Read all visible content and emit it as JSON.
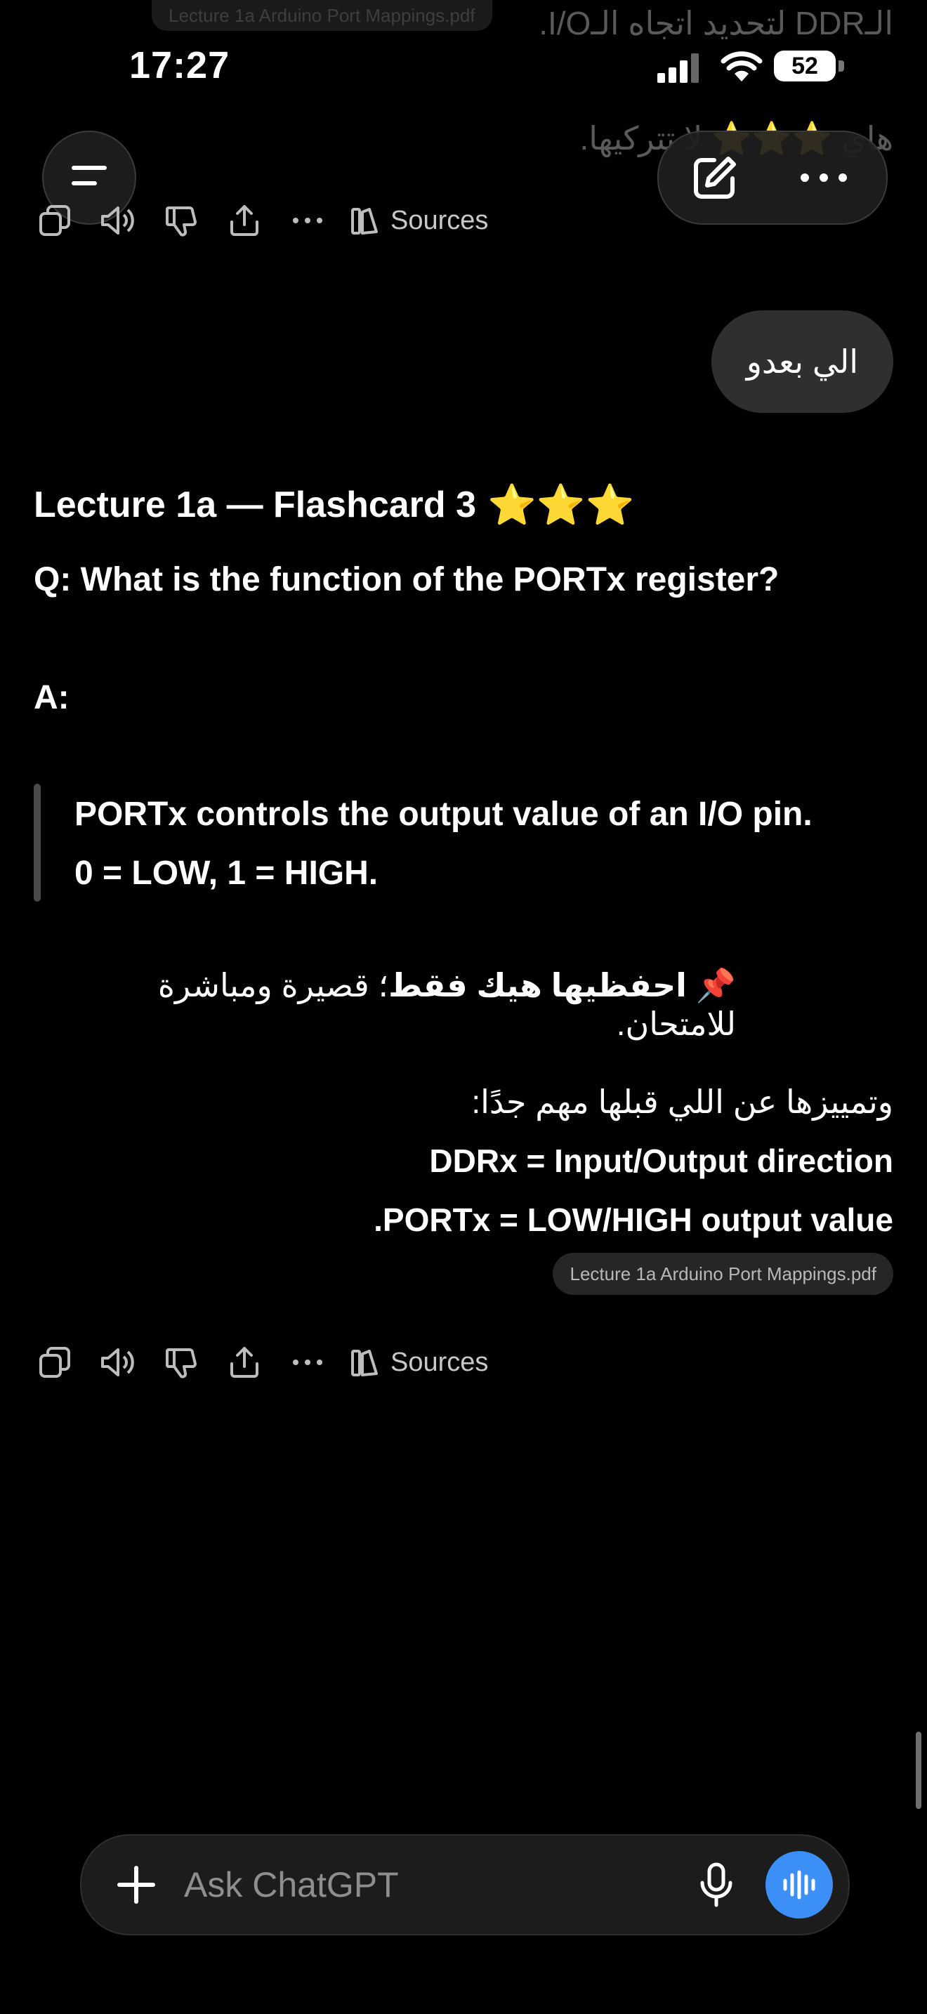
{
  "background_prev": {
    "line1": "الـDDR لتحديد اتجاه الـI/O.",
    "line2": "هاي ⭐⭐⭐ لا تتركيها.",
    "file_chip": "Lecture 1a Arduino Port Mappings.pdf"
  },
  "status_bar": {
    "time": "17:27",
    "battery": "52"
  },
  "prev_actions": {
    "sources_label": "Sources"
  },
  "user_message": {
    "text": "الي بعدو"
  },
  "assistant": {
    "title": "Lecture 1a — Flashcard 3",
    "stars": "⭐⭐⭐",
    "question": "Q: What is the function of the PORTx register?",
    "answer_label": "A:",
    "quote": [
      "PORTx controls the output value of an I/O pin.",
      "0 = LOW, 1 = HIGH."
    ],
    "memorize_bold": "احفظيها هيك فقط",
    "memorize_rest": "؛ قصيرة ومباشرة للامتحان.",
    "pin_emoji": "📌",
    "distinguish_intro": "وتمييزها عن اللي قبلها مهم جدًا:",
    "ddr_line": "DDRx = Input/Output direction",
    "port_line": ".PORTx = LOW/HIGH output value",
    "file_chip": "Lecture 1a Arduino Port Mappings.pdf"
  },
  "actions": {
    "sources_label": "Sources"
  },
  "composer": {
    "placeholder": "Ask ChatGPT"
  },
  "colors": {
    "accent": "#3b8ff6",
    "background": "#000000",
    "bubble": "#2f2f2f"
  }
}
